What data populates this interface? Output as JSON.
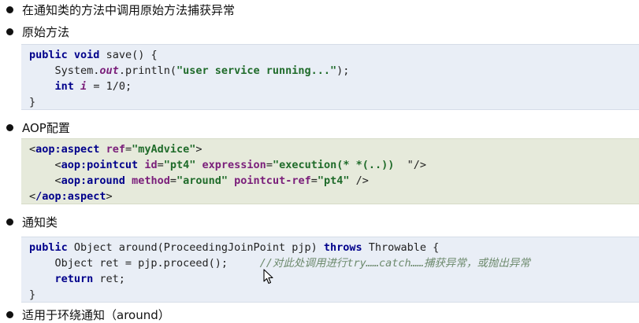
{
  "bullets": [
    "在通知类的方法中调用原始方法捕获异常",
    "原始方法",
    "AOP配置",
    "通知类",
    "适用于环绕通知（around）"
  ],
  "original_method": {
    "line1": {
      "kw1": "public",
      "kw2": "void",
      "rest": " save() {"
    },
    "line2": {
      "a": "System.",
      "field": "out",
      "b": ".println(",
      "str": "\"user service running...\"",
      "c": ");"
    },
    "line3": {
      "kw": "int",
      "var": "i",
      "rest": " = 1/0;"
    },
    "line4": "}"
  },
  "aop_config": {
    "line1": {
      "tag": "aop:aspect",
      "attr": "ref",
      "val": "\"myAdvice\"",
      "close": ">"
    },
    "line2": {
      "tag": "aop:pointcut",
      "attr1": "id",
      "val1": "\"pt4\"",
      "attr2": "expression",
      "val2": "\"execution(* *(..))",
      "tail": "  \"/>"
    },
    "line3": {
      "tag": "aop:around",
      "attr1": "method",
      "val1": "\"around\"",
      "attr2": "pointcut-ref",
      "val2": "\"pt4\"",
      "tail": " />"
    },
    "line4": {
      "tag": "/aop:aspect",
      "close": ">"
    }
  },
  "advice_class": {
    "line1": {
      "kw1": "public",
      "a": " Object around(ProceedingJoinPoint pjp) ",
      "kw2": "throws",
      "b": " Throwable {"
    },
    "line2": {
      "a": "Object ret = pjp.proceed();",
      "comment": "//对此处调用进行try……catch……捕获异常，或抛出异常"
    },
    "line3": {
      "kw": "return",
      "rest": " ret;"
    },
    "line4": "}"
  },
  "icons": {
    "cursor": "mouse-pointer-icon",
    "bullet": "bullet-dot-icon"
  }
}
